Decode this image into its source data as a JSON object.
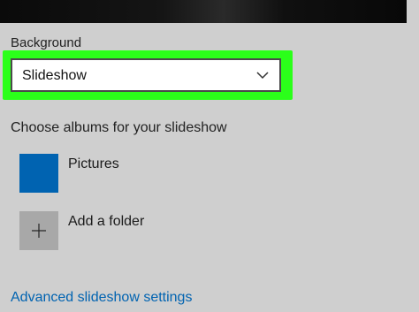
{
  "background_section": {
    "label": "Background",
    "dropdown": {
      "selected_value": "Slideshow",
      "icon": "chevron-down-icon"
    },
    "highlight_color": "#2bff1a"
  },
  "albums_section": {
    "heading": "Choose albums for your slideshow",
    "items": [
      {
        "label": "Pictures",
        "tile_color": "#0063b1"
      },
      {
        "label": "Add a folder",
        "tile_color": "#a8a8a8",
        "icon": "plus-icon"
      }
    ]
  },
  "advanced_link": {
    "label": "Advanced slideshow settings",
    "color": "#0063b1"
  }
}
